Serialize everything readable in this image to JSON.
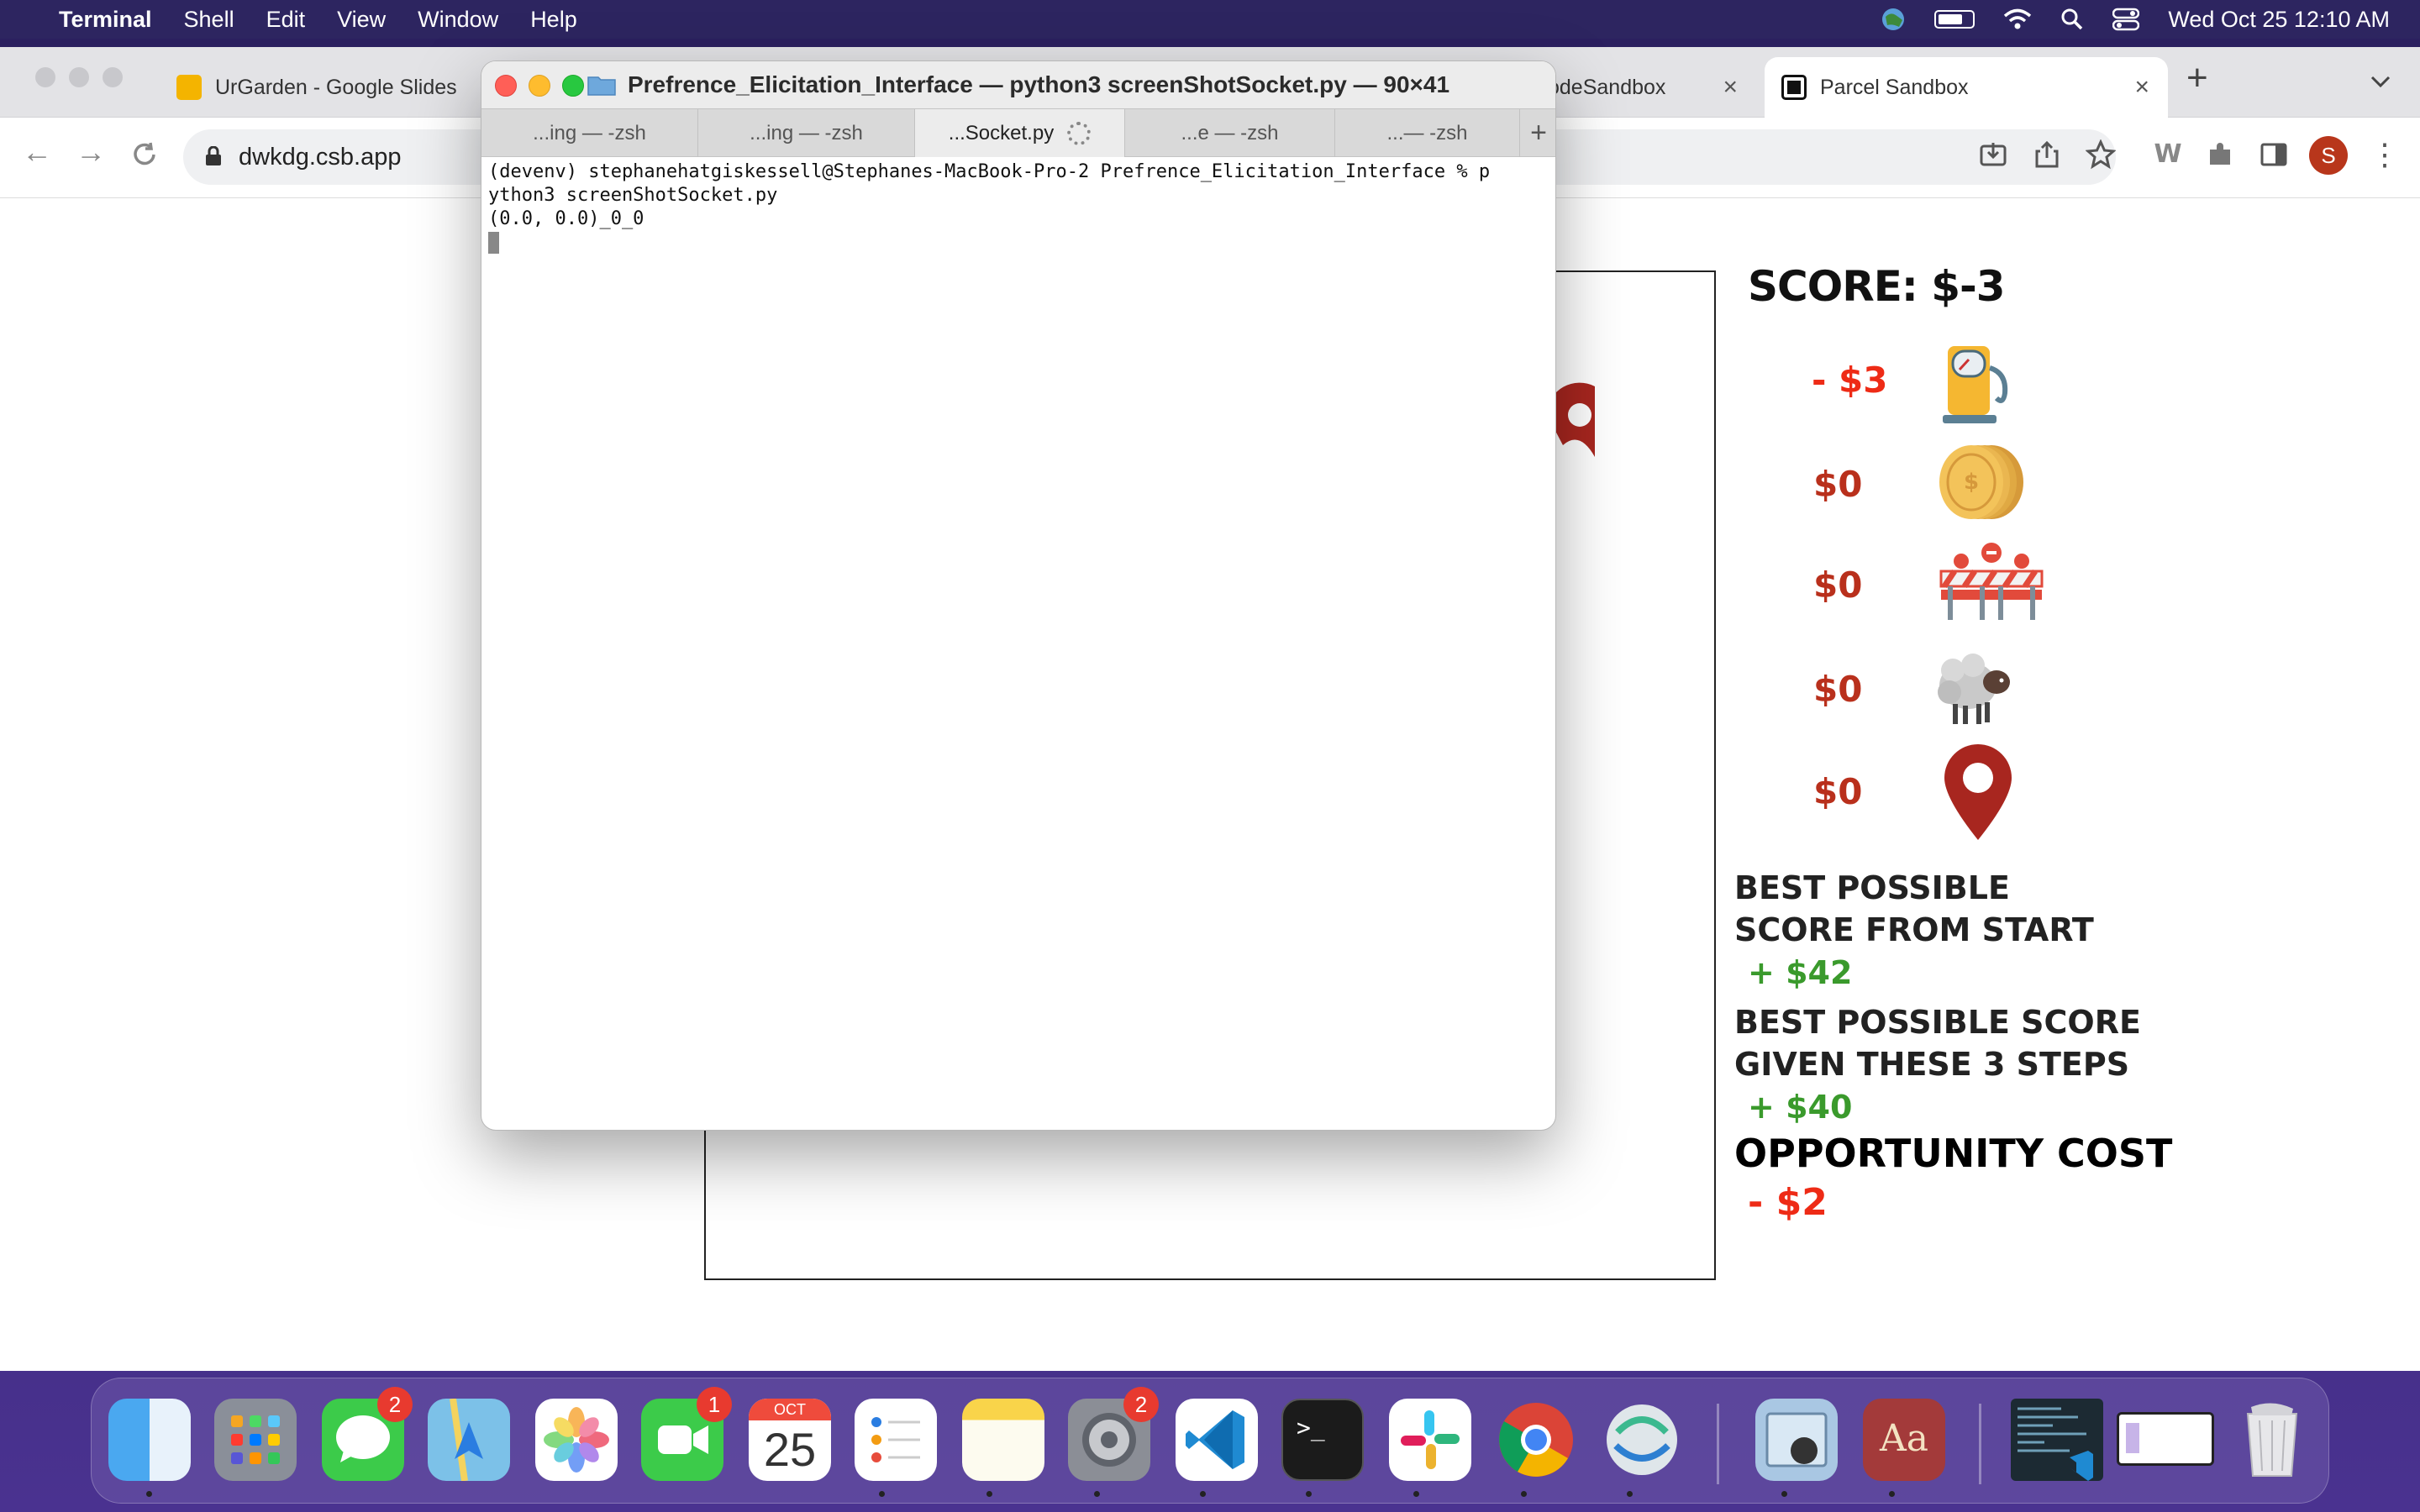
{
  "menubar": {
    "app_name": "Terminal",
    "items": [
      "Shell",
      "Edit",
      "View",
      "Window",
      "Help"
    ],
    "clock": "Wed Oct 25  12:10 AM"
  },
  "browser": {
    "tabs": [
      {
        "label": "UrGarden - Google Slides"
      },
      {
        "label": "odeSandbox"
      },
      {
        "label": "Parcel Sandbox"
      }
    ],
    "url": "dwkdg.csb.app",
    "avatar_letter": "S"
  },
  "game": {
    "score_title": "SCORE: $-3",
    "costs": [
      {
        "value": "- $3",
        "icon": "gas-pump-icon"
      },
      {
        "value": "$0",
        "icon": "coins-icon"
      },
      {
        "value": "$0",
        "icon": "roadblock-icon"
      },
      {
        "value": "$0",
        "icon": "sheep-icon"
      },
      {
        "value": "$0",
        "icon": "location-pin-icon"
      }
    ],
    "best_from_start_label_1": "BEST POSSIBLE",
    "best_from_start_label_2": "SCORE FROM START",
    "best_from_start_value": "+ $42",
    "best_given_label_1": "BEST POSSIBLE SCORE",
    "best_given_label_2": "GIVEN THESE 3 STEPS",
    "best_given_value": "+ $40",
    "opportunity_label": "OPPORTUNITY COST",
    "opportunity_value": "- $2"
  },
  "terminal": {
    "title": "Prefrence_Elicitation_Interface — python3 screenShotSocket.py — 90×41",
    "tabs": [
      "...ing — -zsh",
      "...ing — -zsh",
      "...Socket.py",
      "...e — -zsh",
      "...— -zsh"
    ],
    "new_tab": "+",
    "lines": [
      "(devenv) stephanehatgiskessell@Stephanes-MacBook-Pro-2 Prefrence_Elicitation_Interface % p",
      "ython3 screenShotSocket.py",
      "(0.0, 0.0)_0_0"
    ]
  },
  "dock": {
    "calendar_month": "OCT",
    "calendar_day": "25",
    "messages_badge": "2",
    "facetime_badge": "1",
    "settings_badge": "2",
    "dictionary_label": "Aa"
  },
  "colors": {
    "accent_red": "#b9301c",
    "bright_red": "#ee2b16",
    "green": "#3a9a2c"
  }
}
